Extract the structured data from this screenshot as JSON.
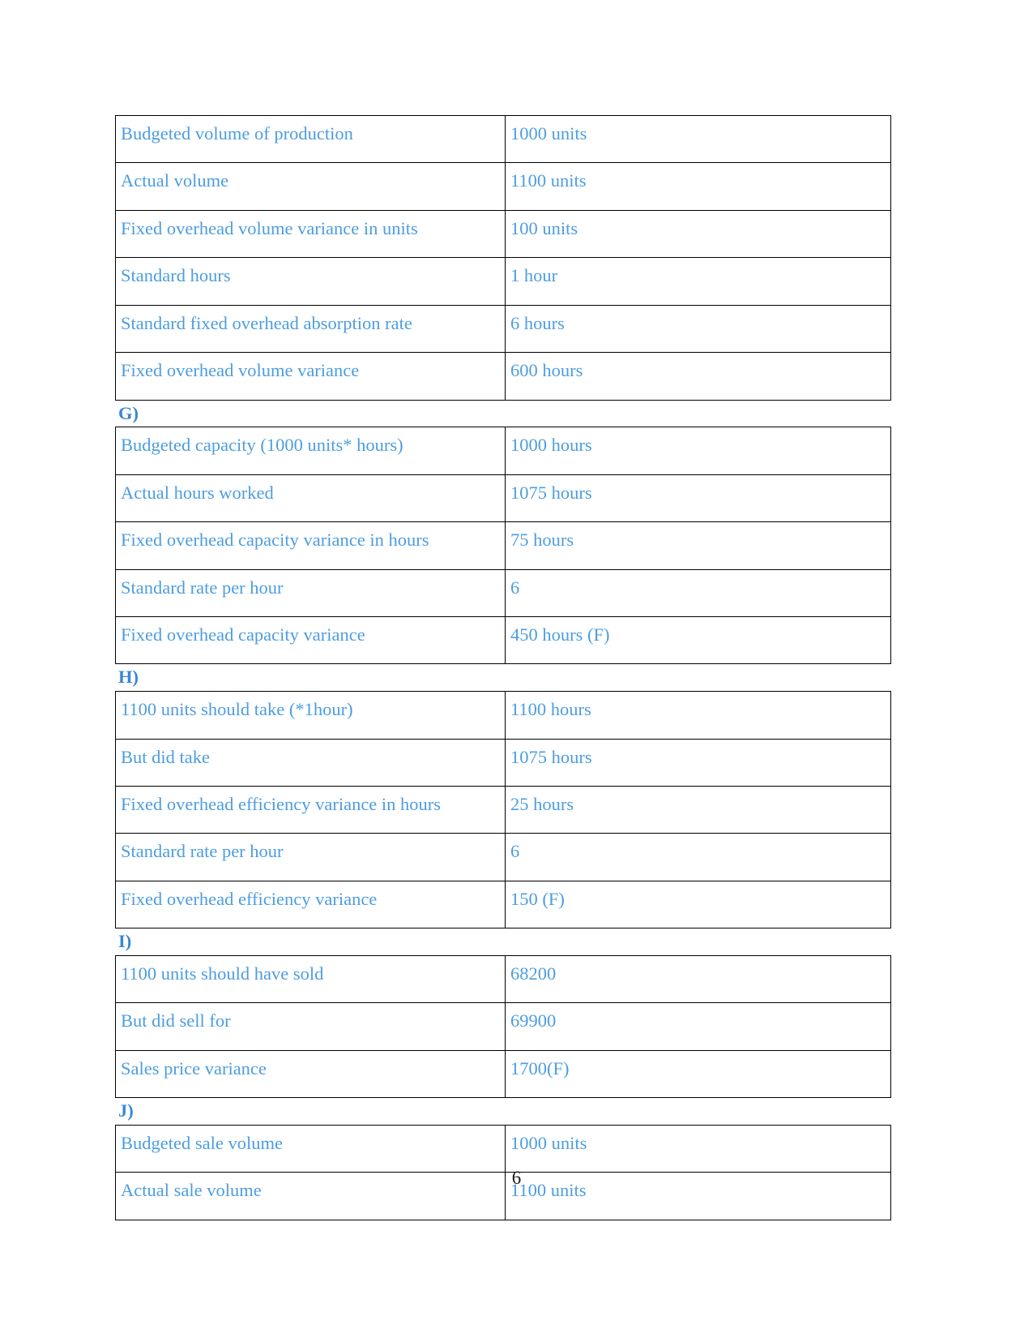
{
  "document": {
    "page_number": "6",
    "text_color": "#4d9de0",
    "label_color": "#3a87d4",
    "border_color": "#000000"
  },
  "sections": [
    {
      "label": "",
      "table": {
        "rows": [
          {
            "label": "Budgeted volume of production",
            "value": "1000 units"
          },
          {
            "label": "Actual volume",
            "value": "1100 units"
          },
          {
            "label": "Fixed overhead volume variance in units",
            "value": "100 units"
          },
          {
            "label": "Standard hours",
            "value": "1 hour"
          },
          {
            "label": "Standard fixed overhead absorption rate",
            "value": "6 hours"
          },
          {
            "label": "Fixed overhead volume variance",
            "value": "600 hours"
          }
        ]
      }
    },
    {
      "label": "G)",
      "table": {
        "rows": [
          {
            "label": "Budgeted capacity (1000 units* hours)",
            "value": "1000 hours"
          },
          {
            "label": "Actual hours worked",
            "value": "1075 hours"
          },
          {
            "label": "Fixed overhead capacity variance in hours",
            "value": "75 hours"
          },
          {
            "label": "Standard rate per hour",
            "value": "6"
          },
          {
            "label": "Fixed overhead capacity variance",
            "value": "450 hours (F)"
          }
        ]
      }
    },
    {
      "label": "H)",
      "table": {
        "rows": [
          {
            "label": "1100 units should take (*1hour)",
            "value": "1100 hours"
          },
          {
            "label": "But did take",
            "value": "1075 hours"
          },
          {
            "label": "Fixed overhead efficiency variance in hours",
            "value": "25 hours"
          },
          {
            "label": "Standard rate per hour",
            "value": "6"
          },
          {
            "label": "Fixed overhead efficiency variance",
            "value": "150 (F)"
          }
        ]
      }
    },
    {
      "label": "I)",
      "table": {
        "rows": [
          {
            "label": "1100 units should have sold",
            "value": "68200"
          },
          {
            "label": "But did sell for",
            "value": "69900"
          },
          {
            "label": "Sales price variance",
            "value": "1700(F)"
          }
        ]
      }
    },
    {
      "label": "J)",
      "table": {
        "rows": [
          {
            "label": "Budgeted sale volume",
            "value": "1000 units"
          },
          {
            "label": "Actual sale volume",
            "value": "1100 units"
          }
        ]
      }
    }
  ]
}
